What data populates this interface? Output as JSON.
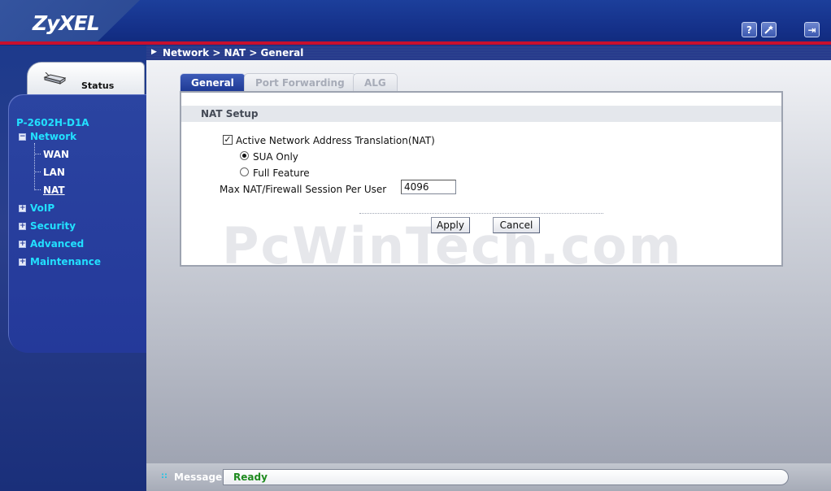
{
  "header": {
    "logo": "ZyXEL",
    "help_icon": "help-icon",
    "wizard_icon": "wizard-icon",
    "logout_icon": "logout-icon",
    "help_glyph": "?",
    "logout_glyph": "⇥"
  },
  "sidebar": {
    "status_label": "Status",
    "device_name": "P-2602H-D1A",
    "nav": [
      {
        "label": "Network",
        "expanded": true,
        "children": [
          {
            "label": "WAN"
          },
          {
            "label": "LAN"
          },
          {
            "label": "NAT",
            "selected": true
          }
        ]
      },
      {
        "label": "VoIP",
        "expanded": false
      },
      {
        "label": "Security",
        "expanded": false
      },
      {
        "label": "Advanced",
        "expanded": false
      },
      {
        "label": "Maintenance",
        "expanded": false
      }
    ],
    "collapse_glyph": "−",
    "expand_glyph": "+"
  },
  "breadcrumb": "Network > NAT > General",
  "tabs": [
    {
      "label": "General",
      "active": true
    },
    {
      "label": "Port Forwarding",
      "active": false
    },
    {
      "label": "ALG",
      "active": false
    }
  ],
  "nat_setup": {
    "title": "NAT Setup",
    "nat_checkbox_label": "Active Network Address Translation(NAT)",
    "nat_checked": true,
    "check_glyph": "✓",
    "sua_only_label": "SUA Only",
    "sua_only_selected": true,
    "full_feature_label": "Full Feature",
    "full_feature_selected": false,
    "session_label": "Max NAT/Firewall Session Per User",
    "session_value": "4096"
  },
  "buttons": {
    "apply": "Apply",
    "cancel": "Cancel"
  },
  "watermark": "PcWinTech.com",
  "message": {
    "label": "Message",
    "text": "Ready",
    "dots": "::"
  },
  "colors": {
    "accent": "#1f3a95",
    "nav_text": "#22e0ff",
    "ready_green": "#1e8a1e",
    "header_red": "#c8102e"
  }
}
